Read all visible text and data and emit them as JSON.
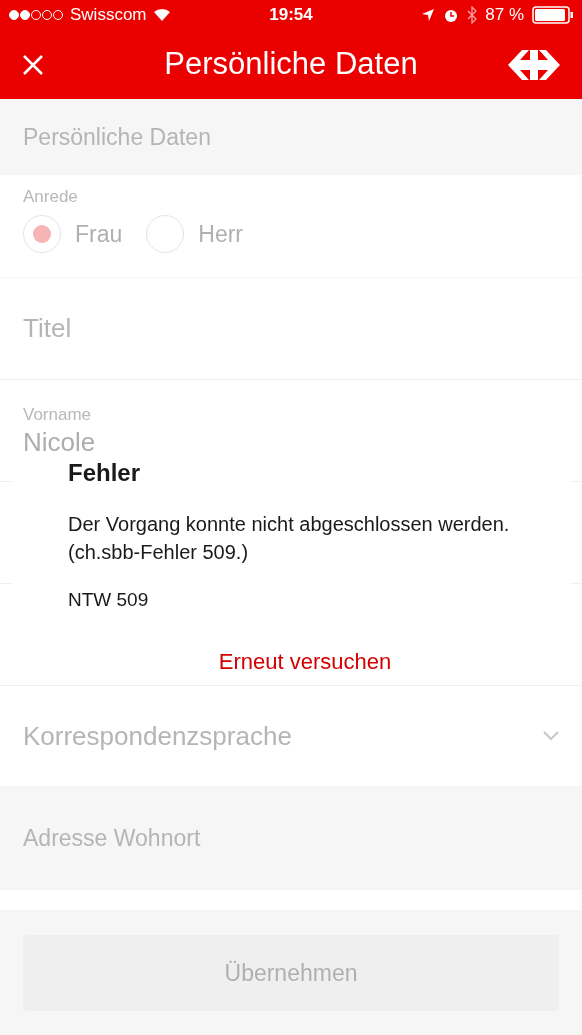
{
  "status_bar": {
    "carrier": "Swisscom",
    "time": "19:54",
    "battery": "87 %"
  },
  "nav_bar": {
    "title": "Persönliche Daten"
  },
  "form": [
    {
      "kind": "header",
      "text": "Persönliche Daten"
    },
    {
      "kind": "radio",
      "label": "Anrede",
      "options": [
        {
          "label": "Frau",
          "selected": true
        },
        {
          "label": "Herr",
          "selected": false
        }
      ]
    },
    {
      "kind": "input",
      "placeholder": "Titel"
    },
    {
      "kind": "input",
      "label": "Vorname",
      "value": "Nicole"
    },
    {
      "kind": "input"
    },
    {
      "kind": "input"
    },
    {
      "kind": "select",
      "placeholder": "Korrespondenzsprache"
    },
    {
      "kind": "header",
      "text": "Adresse Wohnort"
    }
  ],
  "submit_button": {
    "label": "Übernehmen",
    "disabled": true
  },
  "dialog": {
    "title": "Fehler",
    "message": "Der Vorgang konnte nicht abgeschlossen werden. (ch.sbb-Fehler 509.)",
    "code": "NTW 509",
    "action": "Erneut versuchen"
  }
}
